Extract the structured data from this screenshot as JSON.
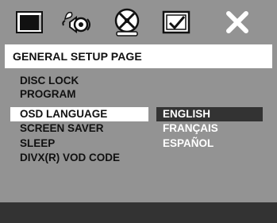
{
  "tabs": [
    {
      "icon": "general-setup-icon"
    },
    {
      "icon": "audio-setup-icon"
    },
    {
      "icon": "dolby-digital-setup-icon"
    },
    {
      "icon": "preference-page-icon"
    },
    {
      "icon": "exit-setup-icon"
    }
  ],
  "page_title": "GENERAL SETUP PAGE",
  "menu_items": [
    "DISC LOCK",
    "PROGRAM",
    "OSD LANGUAGE",
    "SCREEN SAVER",
    "SLEEP",
    "DIVX(R) VOD CODE"
  ],
  "selected_menu_index": 2,
  "options": [
    "ENGLISH",
    "FRANÇAIS",
    "ESPAÑOL"
  ],
  "selected_option_index": 0,
  "colors": {
    "background": "#939393",
    "header_bg": "#ffffff",
    "highlight_bg": "#333333",
    "option_text": "#ffffff",
    "menu_text": "#111111"
  }
}
